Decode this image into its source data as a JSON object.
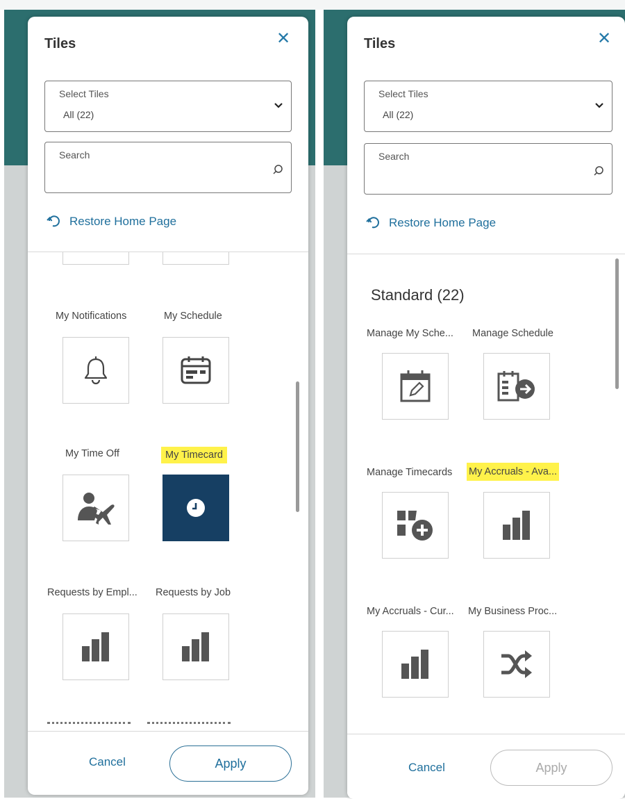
{
  "left_panel": {
    "title": "Tiles",
    "select": {
      "label": "Select Tiles",
      "value": "All (22)"
    },
    "search": {
      "label": "Search",
      "value": ""
    },
    "restore_label": "Restore Home Page",
    "tiles": [
      {
        "label": "My Notifications",
        "icon": "bell-icon",
        "selected": false
      },
      {
        "label": "My Schedule",
        "icon": "calendar-icon",
        "selected": false
      },
      {
        "label": "My Time Off",
        "icon": "person-plane-icon",
        "selected": false
      },
      {
        "label": "My Timecard",
        "icon": "clock-icon",
        "selected": true,
        "highlighted": true
      },
      {
        "label": "Requests by Empl...",
        "icon": "bar-chart-icon",
        "selected": false
      },
      {
        "label": "Requests by Job",
        "icon": "bar-chart-icon",
        "selected": false
      }
    ],
    "cancel_label": "Cancel",
    "apply_label": "Apply"
  },
  "right_panel": {
    "title": "Tiles",
    "select": {
      "label": "Select Tiles",
      "value": "All (22)"
    },
    "search": {
      "label": "Search",
      "value": ""
    },
    "restore_label": "Restore Home Page",
    "section_title": "Standard (22)",
    "tiles": [
      {
        "label": "Manage My Sche...",
        "icon": "calendar-edit-icon",
        "selected": false
      },
      {
        "label": "Manage Schedule",
        "icon": "schedule-arrow-icon",
        "selected": false
      },
      {
        "label": "Manage Timecards",
        "icon": "tiles-add-icon",
        "selected": false
      },
      {
        "label": "My Accruals - Ava...",
        "icon": "bar-chart-icon",
        "selected": false,
        "highlighted": true
      },
      {
        "label": "My Accruals - Cur...",
        "icon": "bar-chart-icon",
        "selected": false
      },
      {
        "label": "My Business Proc...",
        "icon": "shuffle-icon",
        "selected": false
      }
    ],
    "cancel_label": "Cancel",
    "apply_label": "Apply",
    "apply_disabled": true
  },
  "colors": {
    "accent": "#1f6f9c",
    "selected_tile": "#163f63",
    "highlight": "#fff24a",
    "header_bg": "#2c6e6e"
  }
}
